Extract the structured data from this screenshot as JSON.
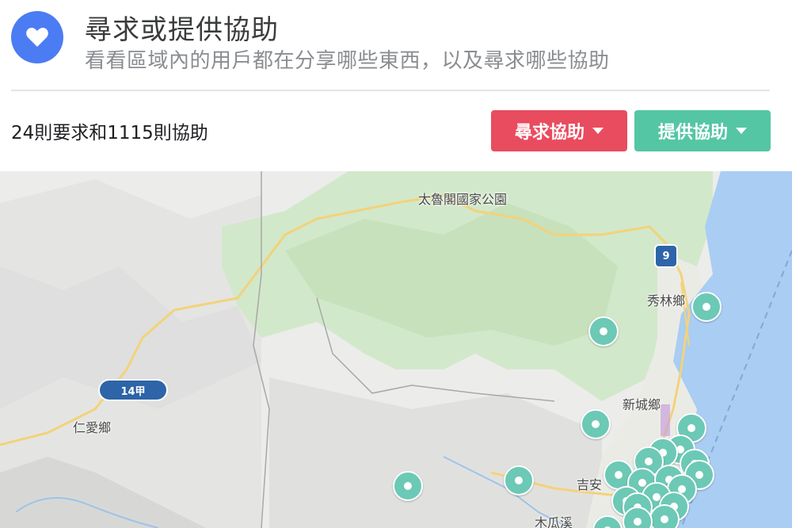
{
  "header": {
    "icon": "heart-icon",
    "badge_color": "#4b7cf3",
    "title": "尋求或提供協助",
    "subtitle": "看看區域內的用戶都在分享哪些東西，以及尋求哪些協助"
  },
  "summary": {
    "text": "24則要求和1115則協助"
  },
  "actions": {
    "request_label": "尋求協助",
    "request_color": "#e94c5f",
    "offer_label": "提供協助",
    "offer_color": "#55c6a4"
  },
  "map": {
    "labels": {
      "park": "太魯閣國家公園",
      "xiulin": "秀林鄉",
      "xincheng": "新城鄉",
      "renai": "仁愛鄉",
      "jian": "吉安",
      "river": "木瓜溪"
    },
    "route_shields": {
      "route_9": "9",
      "route_14a": "14甲"
    },
    "pin_color": "#6cc9b5",
    "pin_icon": "map-pin-icon"
  }
}
